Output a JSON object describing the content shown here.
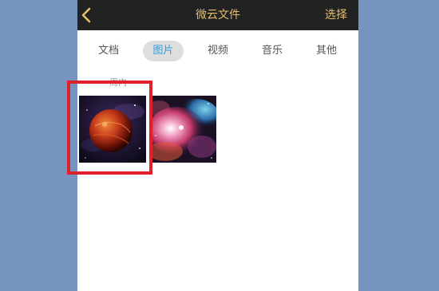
{
  "header": {
    "title": "微云文件",
    "select_label": "选择",
    "back_icon": "chevron-left-icon"
  },
  "tabs": [
    {
      "label": "文档",
      "active": false
    },
    {
      "label": "图片",
      "active": true
    },
    {
      "label": "视频",
      "active": false
    },
    {
      "label": "音乐",
      "active": false
    },
    {
      "label": "其他",
      "active": false
    }
  ],
  "gallery": {
    "section_label": "周内",
    "images": [
      {
        "subject": "red planet"
      },
      {
        "subject": "colorful nebula"
      }
    ]
  },
  "colors": {
    "header_bg": "#222222",
    "header_text": "#e6bf6c",
    "active_tab_text": "#2f9bdb",
    "active_tab_bg": "#dedede",
    "highlight": "#e0202a",
    "backdrop": "#7594bf"
  }
}
